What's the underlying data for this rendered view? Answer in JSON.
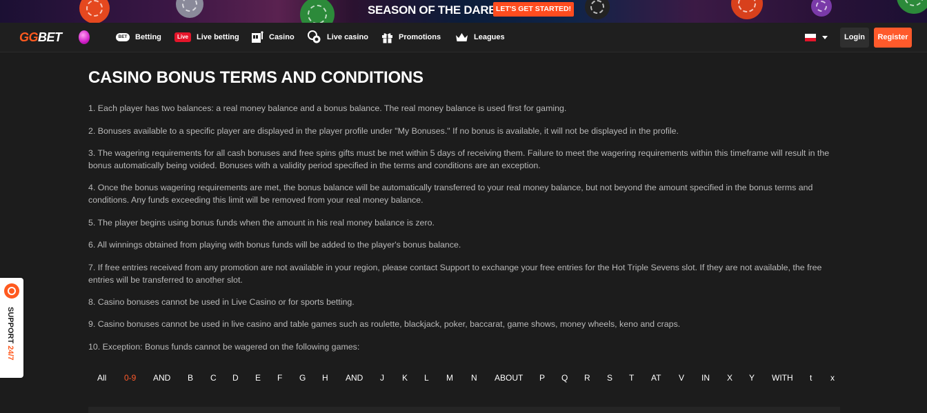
{
  "banner": {
    "title": "SEASON OF THE DARE",
    "cta": "LET'S GET STARTED!"
  },
  "nav": {
    "logo_gg": "GG",
    "logo_bet": "BET",
    "items": [
      {
        "label": "Betting",
        "icon": "bet-badge-icon",
        "badge": "BET"
      },
      {
        "label": "Live betting",
        "icon": "live-badge-icon",
        "badge": "Live"
      },
      {
        "label": "Casino",
        "icon": "slot-machine-icon"
      },
      {
        "label": "Live casino",
        "icon": "chips-icon"
      },
      {
        "label": "Promotions",
        "icon": "gift-icon"
      },
      {
        "label": "Leagues",
        "icon": "crown-icon"
      }
    ],
    "language": "pl",
    "login": "Login",
    "register": "Register"
  },
  "page": {
    "title": "CASINO BONUS TERMS AND CONDITIONS",
    "terms": [
      "1. Each player has two balances: a real money balance and a bonus balance. The real money balance is used first for gaming.",
      "2. Bonuses available to a specific player are displayed in the player profile under \"My Bonuses.\" If no bonus is available, it will not be displayed in the profile.",
      "3. The wagering requirements for all cash bonuses and free spins gifts must be met within 5 days of receiving them. Failure to meet the wagering requirements within this timeframe will result in the bonus automatically being voided. Bonuses with a validity period specified in the terms and conditions are an exception.",
      "4. Once the bonus wagering requirements are met, the bonus balance will be automatically transferred to your real money balance, but not beyond the amount specified in the bonus terms and conditions. Any funds exceeding this limit will be removed from your real money balance.",
      "5. The player begins using bonus funds when the amount in his real money balance is zero.",
      "6. All winnings obtained from playing with bonus funds will be added to the player's bonus balance.",
      "7. If free entries received from any promotion are not available in your region, please contact Support to exchange your free entries for the Hot Triple Sevens slot. If they are not available, the free entries will be transferred to another slot.",
      "8. Casino bonuses cannot be used in Live Casino or for sports betting.",
      "9. Casino bonuses cannot be used in live casino and table games such as roulette, blackjack, poker, baccarat, game shows, money wheels, keno and craps.",
      "10. Exception: Bonus funds cannot be wagered on the following games:"
    ],
    "alphabet": [
      "All",
      "0-9",
      "AND",
      "B",
      "C",
      "D",
      "E",
      "F",
      "G",
      "H",
      "AND",
      "J",
      "K",
      "L",
      "M",
      "N",
      "ABOUT",
      "P",
      "Q",
      "R",
      "S",
      "T",
      "AT",
      "V",
      "IN",
      "X",
      "Y",
      "WITH",
      "t",
      "x"
    ],
    "alphabet_active": "0-9"
  },
  "support": {
    "label_main": "SUPPORT ",
    "label_hours": "24/7"
  },
  "colors": {
    "accent": "#ff5a2b",
    "background": "#1c1c1c",
    "live_red": "#e4152a"
  }
}
